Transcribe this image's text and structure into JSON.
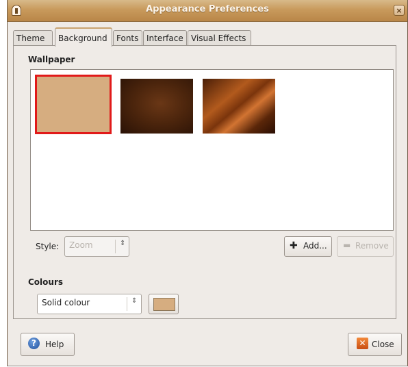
{
  "window": {
    "title": "Appearance Preferences"
  },
  "tabs": [
    {
      "label": "Theme",
      "active": false
    },
    {
      "label": "Background",
      "active": true
    },
    {
      "label": "Fonts",
      "active": false
    },
    {
      "label": "Interface",
      "active": false
    },
    {
      "label": "Visual Effects",
      "active": false
    }
  ],
  "wallpaper": {
    "section_label": "Wallpaper",
    "items": [
      {
        "name": "Solid colour",
        "selected": true,
        "color": "#d6ad80"
      },
      {
        "name": "Brown texture",
        "selected": false
      },
      {
        "name": "Orange waves",
        "selected": false
      }
    ],
    "style_label": "Style:",
    "style_value": "Zoom",
    "add_label": "Add...",
    "remove_label": "Remove"
  },
  "colours": {
    "section_label": "Colours",
    "mode_value": "Solid colour",
    "swatch_color": "#d6ad80"
  },
  "footer": {
    "help_label": "Help",
    "close_label": "Close"
  },
  "colors": {
    "accent": "#c9a36f",
    "selection": "#e11a1a",
    "titlebar": "#c89a5c"
  }
}
